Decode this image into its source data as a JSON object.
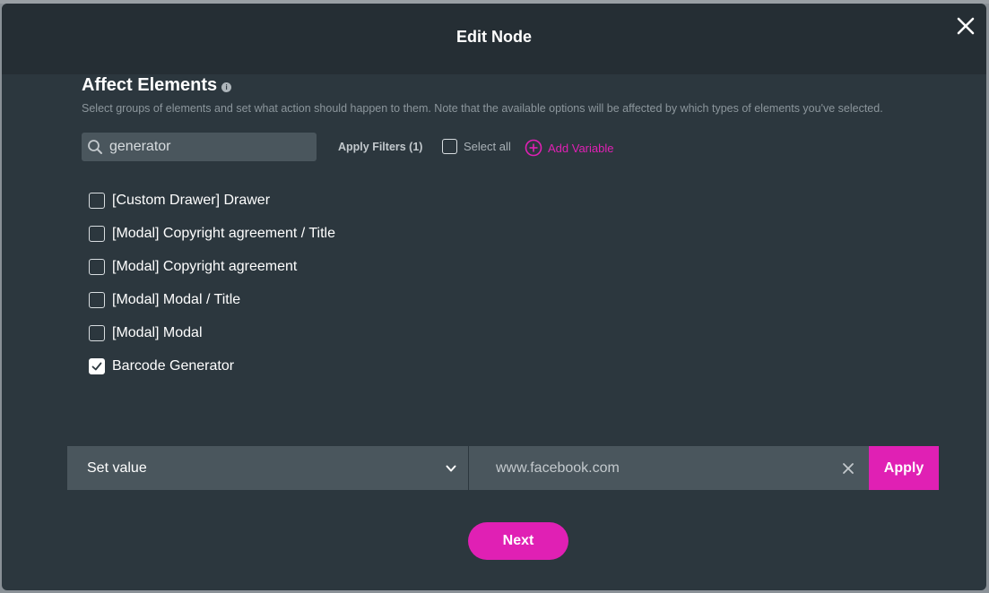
{
  "dialog": {
    "title": "Edit Node"
  },
  "section": {
    "title": "Affect Elements",
    "info_icon": "i",
    "description": "Select groups of elements and set what action should happen to them. Note that the available options will be affected by which types of elements you've selected."
  },
  "search": {
    "value": "generator",
    "placeholder": ""
  },
  "filters": {
    "apply_label": "Apply Filters (1)"
  },
  "select_all": {
    "label": "Select all",
    "checked": false
  },
  "add_variable": {
    "label": "Add Variable"
  },
  "elements": [
    {
      "label": "[Custom Drawer] Drawer",
      "checked": false
    },
    {
      "label": "[Modal] Copyright agreement / Title",
      "checked": false
    },
    {
      "label": "[Modal] Copyright agreement",
      "checked": false
    },
    {
      "label": "[Modal] Modal / Title",
      "checked": false
    },
    {
      "label": "[Modal] Modal",
      "checked": false
    },
    {
      "label": "Barcode Generator",
      "checked": true
    }
  ],
  "action": {
    "selected": "Set value",
    "value": "www.facebook.com",
    "apply_label": "Apply"
  },
  "footer": {
    "next_label": "Next"
  },
  "colors": {
    "accent": "#e020b4",
    "dialog_bg": "#2c373e",
    "header_bg": "#252e34",
    "field_bg": "#4a565d"
  }
}
